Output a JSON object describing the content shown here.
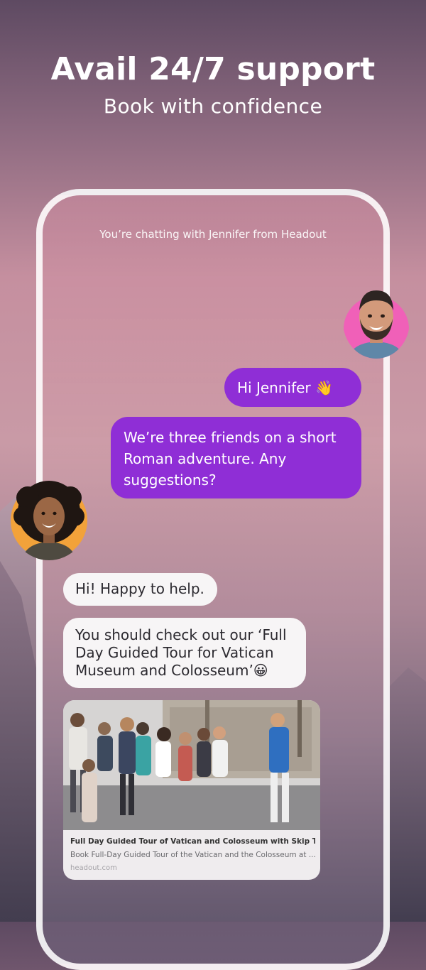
{
  "promo": {
    "headline": "Avail 24/7 support",
    "subheadline": "Book with confidence"
  },
  "chat": {
    "header": "You’re chatting with Jennifer from Headout",
    "messages": [
      {
        "from": "user",
        "text": "Hi Jennifer 👋"
      },
      {
        "from": "user",
        "text": "We’re three friends on a short Roman adventure. Any suggestions?"
      },
      {
        "from": "agent",
        "text": "Hi! Happy to help."
      },
      {
        "from": "agent",
        "text": "You should check out our ‘Full Day Guided Tour for Vatican Museum and Colosseum’😀"
      }
    ],
    "link_card": {
      "title": "Full Day Guided Tour of Vatican and Colosseum with Skip The Li...",
      "description": "Book Full-Day Guided Tour of the Vatican and the Colosseum at ...",
      "domain": "headout.com"
    }
  },
  "colors": {
    "user_bubble": "#8f2ed6",
    "agent_bubble": "#f7f5f6",
    "user_avatar_ring": "#f060b8",
    "agent_avatar_ring": "#f2a23a"
  },
  "icons": {
    "user_avatar": "user-avatar",
    "agent_avatar": "agent-avatar"
  }
}
